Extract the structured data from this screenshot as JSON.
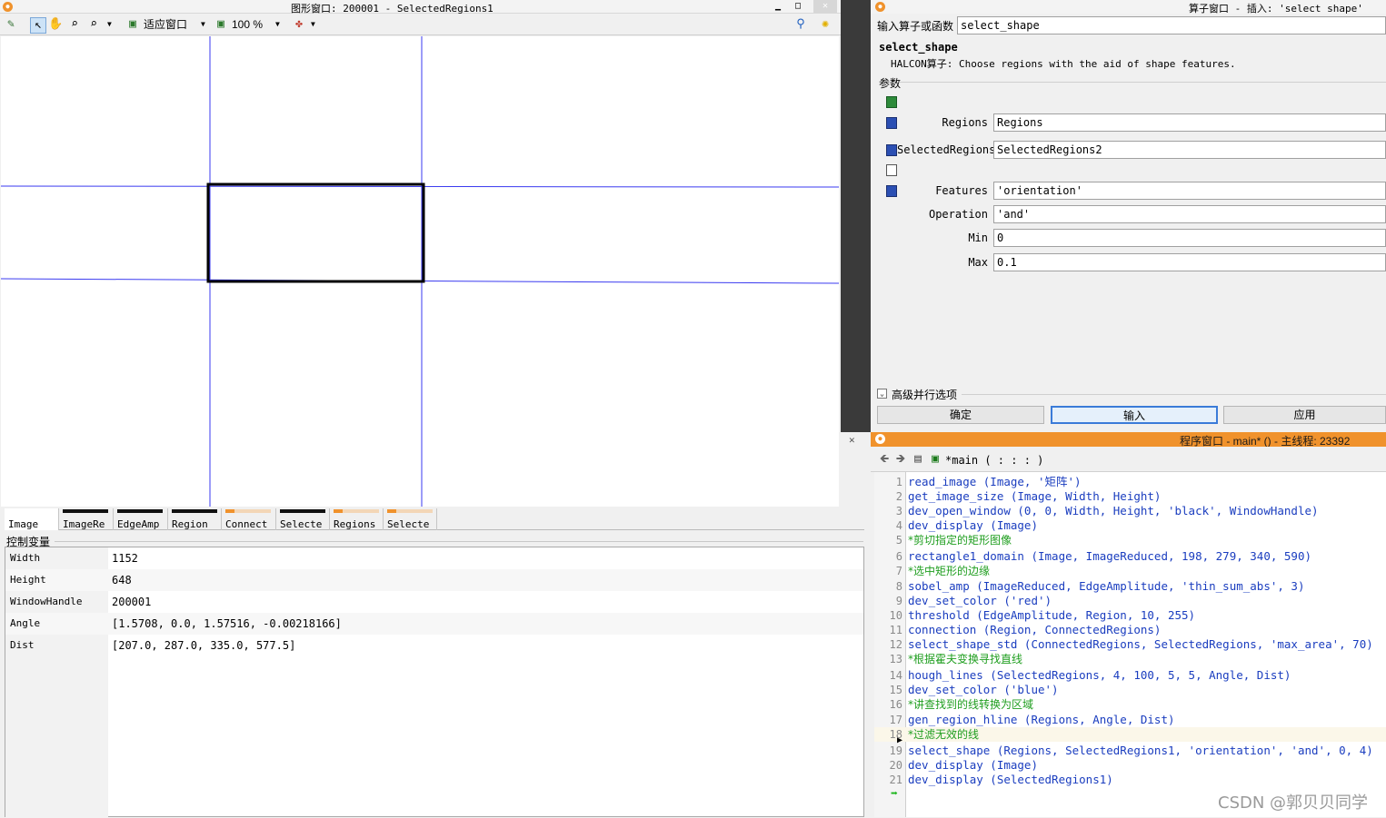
{
  "graphics_window": {
    "title": "图形窗口: 200001 - SelectedRegions1",
    "toolbar": {
      "fit_label": "适应窗口",
      "zoom_label": "100 %"
    }
  },
  "variables_window": {
    "tabs": [
      "Image",
      "ImageRe",
      "EdgeAmp",
      "Region",
      "Connect",
      "Selecte",
      "Regions",
      "Selecte"
    ],
    "control_label": "控制变量",
    "rows": [
      {
        "name": "Width",
        "value": "1152"
      },
      {
        "name": "Height",
        "value": "648"
      },
      {
        "name": "WindowHandle",
        "value": "200001"
      },
      {
        "name": "Angle",
        "value": "[1.5708, 0.0, 1.57516, -0.00218166]"
      },
      {
        "name": "Dist",
        "value": "[207.0, 287.0, 335.0, 577.5]"
      }
    ]
  },
  "operator_window": {
    "title": "算子窗口 - 插入: 'select_shape'",
    "input_label": "输入算子或函数",
    "input_value": "select_shape",
    "operator_name": "select_shape",
    "description": "HALCON算子: Choose regions with the aid of shape features.",
    "params_label": "参数",
    "params": [
      {
        "label": "Regions",
        "value": "Regions"
      },
      {
        "label": "SelectedRegions",
        "value": "SelectedRegions2"
      },
      {
        "label": "Features",
        "value": "'orientation'"
      },
      {
        "label": "Operation",
        "value": "'and'"
      },
      {
        "label": "Min",
        "value": "0"
      },
      {
        "label": "Max",
        "value": "0.1"
      }
    ],
    "advanced_label": "高级并行选项",
    "buttons": {
      "ok": "确定",
      "enter": "输入",
      "apply": "应用"
    }
  },
  "program_window": {
    "title": "程序窗口 - main* () - 主线程: 23392",
    "procedure": "*main ( : : : )",
    "lines": [
      {
        "n": "1",
        "type": "op",
        "text": "read_image (Image, '矩阵')"
      },
      {
        "n": "2",
        "type": "op",
        "text": "get_image_size (Image, Width, Height)"
      },
      {
        "n": "3",
        "type": "op",
        "text": "dev_open_window (0, 0, Width, Height, 'black', WindowHandle)"
      },
      {
        "n": "4",
        "type": "op",
        "text": "dev_display (Image)"
      },
      {
        "n": "5",
        "type": "cm",
        "text": "*剪切指定的矩形图像"
      },
      {
        "n": "6",
        "type": "op",
        "text": "rectangle1_domain (Image, ImageReduced, 198, 279, 340, 590)"
      },
      {
        "n": "7",
        "type": "cm",
        "text": "*选中矩形的边缘"
      },
      {
        "n": "8",
        "type": "op",
        "text": "sobel_amp (ImageReduced, EdgeAmplitude, 'thin_sum_abs', 3)"
      },
      {
        "n": "9",
        "type": "op",
        "text": "dev_set_color ('red')"
      },
      {
        "n": "10",
        "type": "op",
        "text": "threshold (EdgeAmplitude, Region, 10, 255)"
      },
      {
        "n": "11",
        "type": "op",
        "text": "connection (Region, ConnectedRegions)"
      },
      {
        "n": "12",
        "type": "op",
        "text": "select_shape_std (ConnectedRegions, SelectedRegions, 'max_area', 70)"
      },
      {
        "n": "13",
        "type": "cm",
        "text": "*根据霍夫变换寻找直线"
      },
      {
        "n": "14",
        "type": "op",
        "text": "hough_lines (SelectedRegions, 4, 100, 5, 5, Angle, Dist)"
      },
      {
        "n": "15",
        "type": "op",
        "text": "dev_set_color ('blue')"
      },
      {
        "n": "16",
        "type": "cm",
        "text": "*讲查找到的线转换为区域"
      },
      {
        "n": "17",
        "type": "op",
        "text": "gen_region_hline (Regions, Angle, Dist)"
      },
      {
        "n": "18",
        "type": "cm",
        "text": "*过滤无效的线"
      },
      {
        "n": "19",
        "type": "op",
        "text": "select_shape (Regions, SelectedRegions1, 'orientation', 'and', 0, 4)"
      },
      {
        "n": "20",
        "type": "op",
        "text": "dev_display (Image)"
      },
      {
        "n": "21",
        "type": "op",
        "text": "dev_display (SelectedRegions1)"
      }
    ],
    "current_line": "18"
  },
  "watermark": "CSDN @郭贝贝同学",
  "colors": {
    "program_title_bar": "#f0922c",
    "operator_code": "#1a3dbf",
    "comment_code": "#1f9e1f",
    "hough_lines": "#3a3af0"
  }
}
